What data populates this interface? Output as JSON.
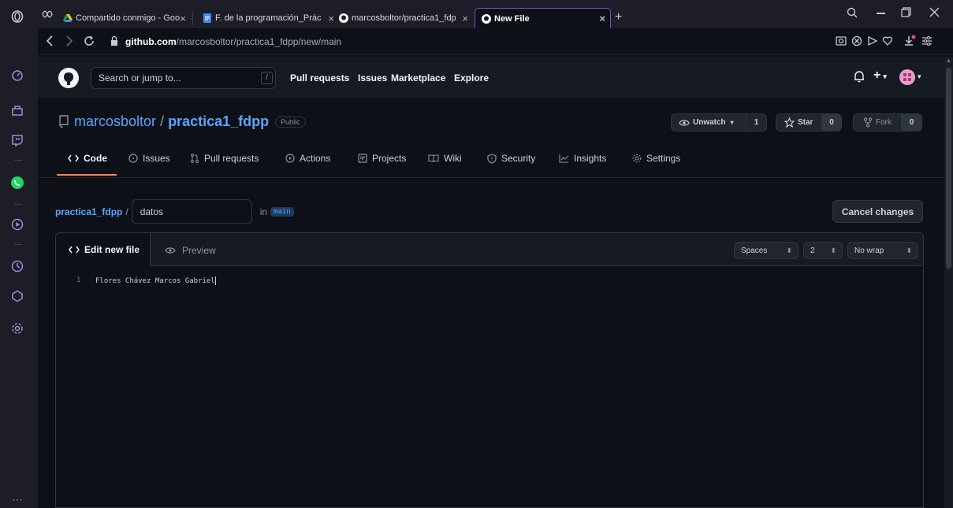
{
  "browser": {
    "tabs": [
      {
        "title": "Compartido conmigo - Goo",
        "close": "×"
      },
      {
        "title": "F. de la programación_Prác",
        "close": "×"
      },
      {
        "title": "marcosboltor/practica1_fdp",
        "close": "×"
      },
      {
        "title": "New File",
        "close": "×"
      }
    ],
    "new_tab": "+",
    "url_host": "github.com",
    "url_path": "/marcosboltor/practica1_fdpp/new/main"
  },
  "github": {
    "search_placeholder": "Search or jump to...",
    "search_shortcut": "/",
    "nav": [
      "Pull requests",
      "Issues",
      "Marketplace",
      "Explore"
    ]
  },
  "repo": {
    "owner": "marcosboltor",
    "separator": "/",
    "name": "practica1_fdpp",
    "visibility": "Public",
    "unwatch_label": "Unwatch",
    "watch_count": "1",
    "star_label": "Star",
    "star_count": "0",
    "fork_label": "Fork",
    "fork_count": "0",
    "tabs": [
      "Code",
      "Issues",
      "Pull requests",
      "Actions",
      "Projects",
      "Wiki",
      "Security",
      "Insights",
      "Settings"
    ]
  },
  "edit": {
    "breadcrumb_repo": "practica1_fdpp",
    "breadcrumb_sep": "/",
    "filename": "datos",
    "in_label": "in",
    "branch": "main",
    "cancel_label": "Cancel changes",
    "tab_edit": "Edit new file",
    "tab_preview": "Preview",
    "indent_mode": "Spaces",
    "indent_size": "2",
    "wrap_mode": "No wrap",
    "line_number": "1",
    "line_text": "Flores Chávez Marcos Gabriel"
  },
  "colors": {
    "accent": "#58a6ff",
    "underline": "#f78166",
    "opera": "#9b8fd9"
  }
}
